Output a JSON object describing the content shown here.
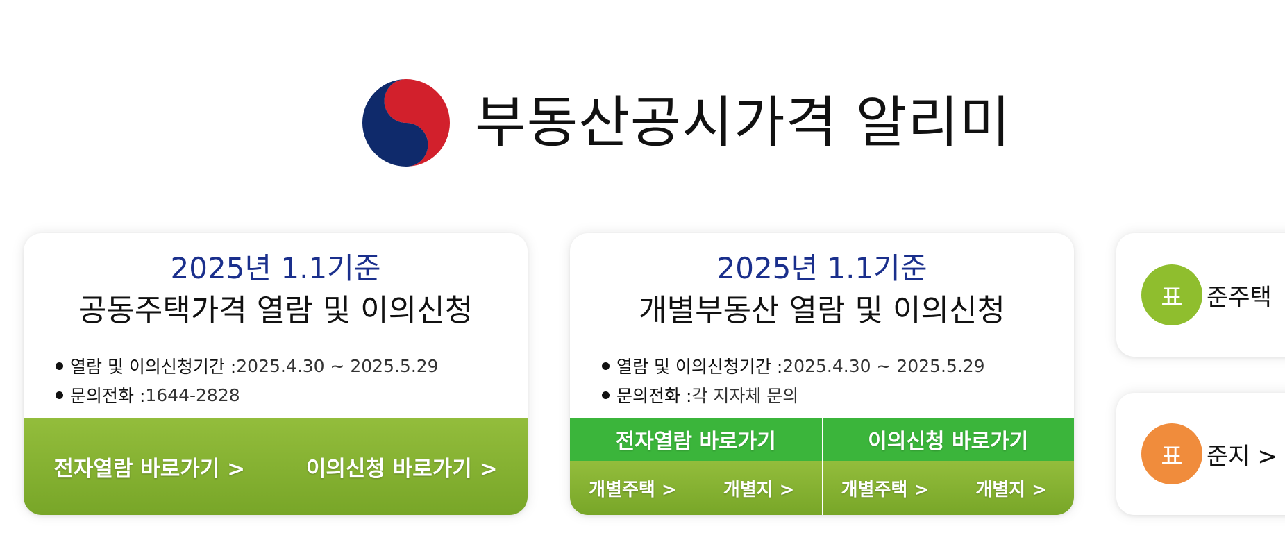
{
  "header": {
    "title": "부동산공시가격 알리미",
    "emblem_icon": "korea-government-emblem-icon",
    "colors": {
      "red": "#d2202c",
      "blue": "#0f2a6b"
    }
  },
  "cards": [
    {
      "date": "2025년 1.1기준",
      "title": "공동주택가격 열람 및 이의신청",
      "info": [
        {
          "label": "열람 및 이의신청기간 : ",
          "value": "2025.4.30 ~ 2025.5.29"
        },
        {
          "label": "문의전화 : ",
          "value": "1644-2828"
        }
      ],
      "buttons": [
        "전자열람 바로가기 >",
        "이의신청 바로가기 >"
      ]
    },
    {
      "date": "2025년 1.1기준",
      "title": "개별부동산 열람 및 이의신청",
      "info": [
        {
          "label": "열람 및 이의신청기간 : ",
          "value": "2025.4.30 ~ 2025.5.29"
        },
        {
          "label": "문의전화 : ",
          "value": "각 지자체 문의"
        }
      ],
      "groups": [
        {
          "label": "전자열람 바로가기",
          "sub": [
            "개별주택 >",
            "개별지 >"
          ]
        },
        {
          "label": "이의신청 바로가기",
          "sub": [
            "개별주택 >",
            "개별지 >"
          ]
        }
      ]
    }
  ],
  "side": [
    {
      "badge": "표",
      "text": "준주택",
      "color": "#8fbe2e"
    },
    {
      "badge": "표",
      "text": "준지  >",
      "color": "#f08c3c"
    }
  ],
  "colors": {
    "date_blue": "#1a2f8c",
    "button_green": "#86b232",
    "header_green": "#3bb53b"
  }
}
